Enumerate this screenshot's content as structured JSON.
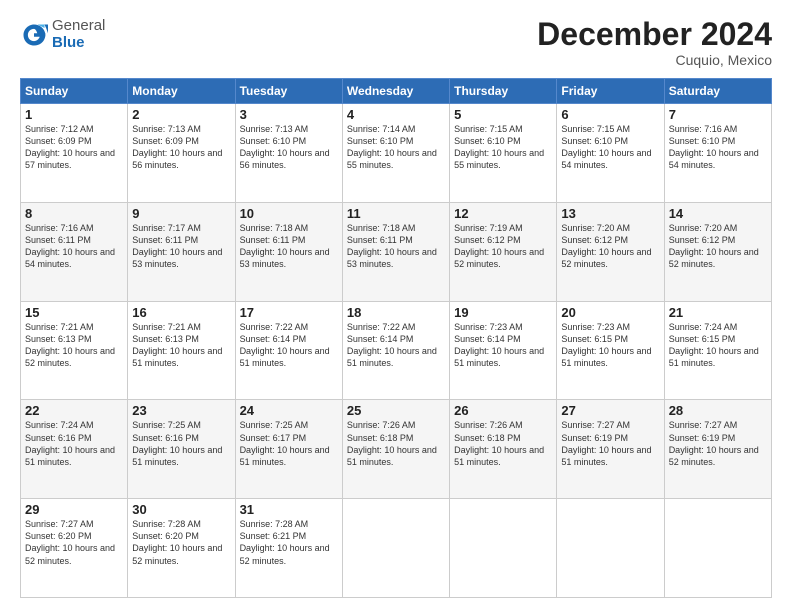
{
  "logo": {
    "general": "General",
    "blue": "Blue"
  },
  "header": {
    "month": "December 2024",
    "location": "Cuquio, Mexico"
  },
  "days_of_week": [
    "Sunday",
    "Monday",
    "Tuesday",
    "Wednesday",
    "Thursday",
    "Friday",
    "Saturday"
  ],
  "weeks": [
    [
      {
        "day": "1",
        "sunrise": "7:12 AM",
        "sunset": "6:09 PM",
        "daylight": "10 hours and 57 minutes."
      },
      {
        "day": "2",
        "sunrise": "7:13 AM",
        "sunset": "6:09 PM",
        "daylight": "10 hours and 56 minutes."
      },
      {
        "day": "3",
        "sunrise": "7:13 AM",
        "sunset": "6:10 PM",
        "daylight": "10 hours and 56 minutes."
      },
      {
        "day": "4",
        "sunrise": "7:14 AM",
        "sunset": "6:10 PM",
        "daylight": "10 hours and 55 minutes."
      },
      {
        "day": "5",
        "sunrise": "7:15 AM",
        "sunset": "6:10 PM",
        "daylight": "10 hours and 55 minutes."
      },
      {
        "day": "6",
        "sunrise": "7:15 AM",
        "sunset": "6:10 PM",
        "daylight": "10 hours and 54 minutes."
      },
      {
        "day": "7",
        "sunrise": "7:16 AM",
        "sunset": "6:10 PM",
        "daylight": "10 hours and 54 minutes."
      }
    ],
    [
      {
        "day": "8",
        "sunrise": "7:16 AM",
        "sunset": "6:11 PM",
        "daylight": "10 hours and 54 minutes."
      },
      {
        "day": "9",
        "sunrise": "7:17 AM",
        "sunset": "6:11 PM",
        "daylight": "10 hours and 53 minutes."
      },
      {
        "day": "10",
        "sunrise": "7:18 AM",
        "sunset": "6:11 PM",
        "daylight": "10 hours and 53 minutes."
      },
      {
        "day": "11",
        "sunrise": "7:18 AM",
        "sunset": "6:11 PM",
        "daylight": "10 hours and 53 minutes."
      },
      {
        "day": "12",
        "sunrise": "7:19 AM",
        "sunset": "6:12 PM",
        "daylight": "10 hours and 52 minutes."
      },
      {
        "day": "13",
        "sunrise": "7:20 AM",
        "sunset": "6:12 PM",
        "daylight": "10 hours and 52 minutes."
      },
      {
        "day": "14",
        "sunrise": "7:20 AM",
        "sunset": "6:12 PM",
        "daylight": "10 hours and 52 minutes."
      }
    ],
    [
      {
        "day": "15",
        "sunrise": "7:21 AM",
        "sunset": "6:13 PM",
        "daylight": "10 hours and 52 minutes."
      },
      {
        "day": "16",
        "sunrise": "7:21 AM",
        "sunset": "6:13 PM",
        "daylight": "10 hours and 51 minutes."
      },
      {
        "day": "17",
        "sunrise": "7:22 AM",
        "sunset": "6:14 PM",
        "daylight": "10 hours and 51 minutes."
      },
      {
        "day": "18",
        "sunrise": "7:22 AM",
        "sunset": "6:14 PM",
        "daylight": "10 hours and 51 minutes."
      },
      {
        "day": "19",
        "sunrise": "7:23 AM",
        "sunset": "6:14 PM",
        "daylight": "10 hours and 51 minutes."
      },
      {
        "day": "20",
        "sunrise": "7:23 AM",
        "sunset": "6:15 PM",
        "daylight": "10 hours and 51 minutes."
      },
      {
        "day": "21",
        "sunrise": "7:24 AM",
        "sunset": "6:15 PM",
        "daylight": "10 hours and 51 minutes."
      }
    ],
    [
      {
        "day": "22",
        "sunrise": "7:24 AM",
        "sunset": "6:16 PM",
        "daylight": "10 hours and 51 minutes."
      },
      {
        "day": "23",
        "sunrise": "7:25 AM",
        "sunset": "6:16 PM",
        "daylight": "10 hours and 51 minutes."
      },
      {
        "day": "24",
        "sunrise": "7:25 AM",
        "sunset": "6:17 PM",
        "daylight": "10 hours and 51 minutes."
      },
      {
        "day": "25",
        "sunrise": "7:26 AM",
        "sunset": "6:18 PM",
        "daylight": "10 hours and 51 minutes."
      },
      {
        "day": "26",
        "sunrise": "7:26 AM",
        "sunset": "6:18 PM",
        "daylight": "10 hours and 51 minutes."
      },
      {
        "day": "27",
        "sunrise": "7:27 AM",
        "sunset": "6:19 PM",
        "daylight": "10 hours and 51 minutes."
      },
      {
        "day": "28",
        "sunrise": "7:27 AM",
        "sunset": "6:19 PM",
        "daylight": "10 hours and 52 minutes."
      }
    ],
    [
      {
        "day": "29",
        "sunrise": "7:27 AM",
        "sunset": "6:20 PM",
        "daylight": "10 hours and 52 minutes."
      },
      {
        "day": "30",
        "sunrise": "7:28 AM",
        "sunset": "6:20 PM",
        "daylight": "10 hours and 52 minutes."
      },
      {
        "day": "31",
        "sunrise": "7:28 AM",
        "sunset": "6:21 PM",
        "daylight": "10 hours and 52 minutes."
      },
      null,
      null,
      null,
      null
    ]
  ]
}
